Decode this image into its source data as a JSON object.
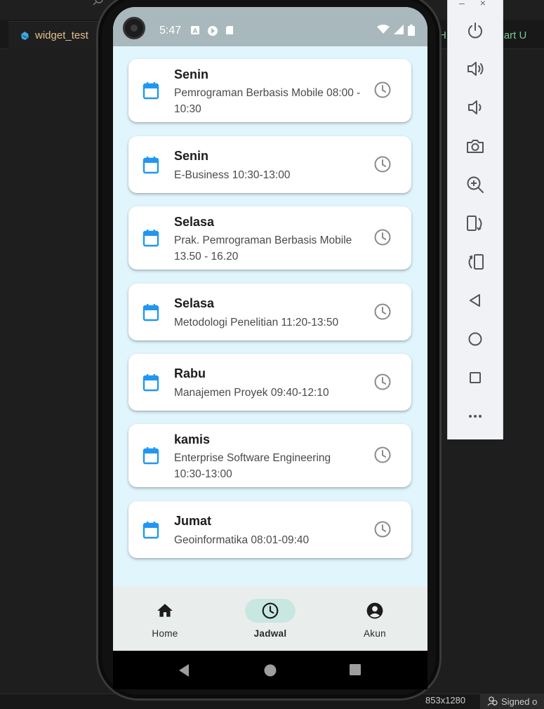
{
  "ide": {
    "tab_label": "widget_test",
    "right_tab_prefix": "H",
    "right_tab_suffix": "art U",
    "status_resolution": "853x1280",
    "status_signed": "Signed o"
  },
  "statusbar": {
    "time": "5:47"
  },
  "schedule": [
    {
      "day": "Senin",
      "desc": "Pemrograman Berbasis Mobile 08:00 - 10:30"
    },
    {
      "day": "Senin",
      "desc": "E-Business 10:30-13:00"
    },
    {
      "day": "Selasa",
      "desc": "Prak. Pemrograman Berbasis Mobile 13.50 - 16.20"
    },
    {
      "day": "Selasa",
      "desc": "Metodologi Penelitian 11:20-13:50"
    },
    {
      "day": "Rabu",
      "desc": "Manajemen Proyek 09:40-12:10"
    },
    {
      "day": "kamis",
      "desc": "Enterprise Software Engineering 10:30-13:00"
    },
    {
      "day": "Jumat",
      "desc": "Geoinformatika 08:01-09:40"
    }
  ],
  "bottom_nav": [
    {
      "label": "Home",
      "icon": "home-icon",
      "active": false
    },
    {
      "label": "Jadwal",
      "icon": "clock-icon",
      "active": true
    },
    {
      "label": "Akun",
      "icon": "account-circle-icon",
      "active": false
    }
  ],
  "emulator_controls": [
    "power-icon",
    "volume-up-icon",
    "volume-down-icon",
    "camera-icon",
    "zoom-in-icon",
    "rotate-left-icon",
    "rotate-right-icon",
    "back-icon",
    "home-circle-icon",
    "overview-icon",
    "more-icon"
  ],
  "colors": {
    "accent_blue": "#2196f3",
    "screen_bg": "#e1f5fd",
    "status_bar": "#a9b8bd",
    "nav_active_pill": "#c9e7e1"
  }
}
